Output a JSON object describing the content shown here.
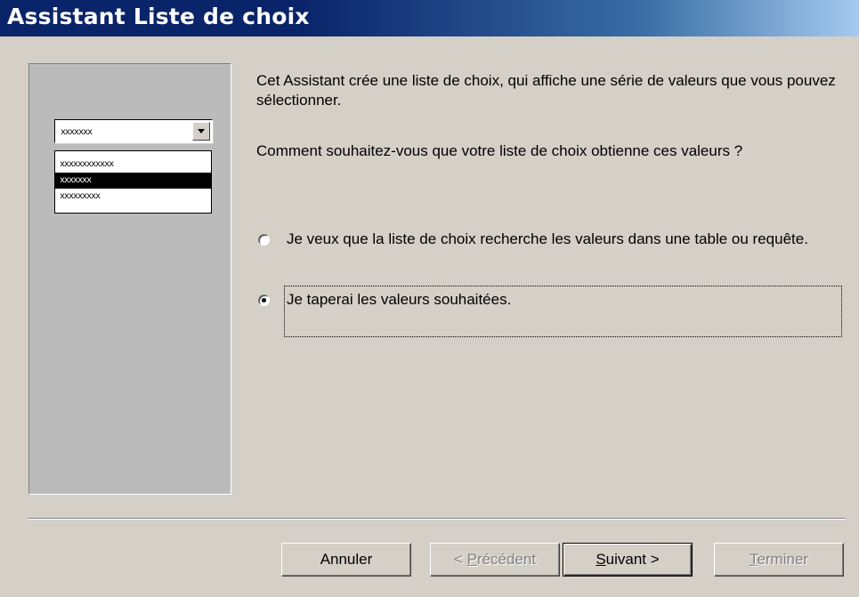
{
  "window": {
    "title": "Assistant Liste de choix"
  },
  "preview": {
    "combo_value": "xxxxxxx",
    "list_items": [
      "xxxxxxxxxxxx",
      "xxxxxxx",
      "xxxxxxxxx"
    ],
    "selected_index": 1
  },
  "intro_text": "Cet Assistant crée une liste de choix, qui affiche une série de valeurs que vous pouvez sélectionner.",
  "question_text": "Comment souhaitez-vous que votre liste de choix obtienne ces valeurs ?",
  "options": [
    {
      "label": "Je veux que la liste de choix recherche les valeurs dans une table ou requête.",
      "checked": false
    },
    {
      "label": "Je taperai les valeurs souhaitées.",
      "checked": true
    }
  ],
  "buttons": {
    "cancel": "Annuler",
    "previous": {
      "mnemonic": "P",
      "rest": "récédent",
      "prefix": "< "
    },
    "next": {
      "mnemonic": "S",
      "rest": "uivant >"
    },
    "finish": {
      "mnemonic": "T",
      "rest": "erminer"
    }
  }
}
